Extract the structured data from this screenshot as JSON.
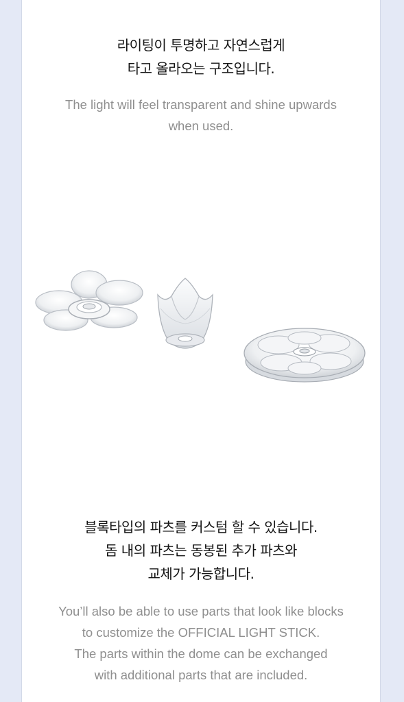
{
  "section1": {
    "ko_lines": [
      "라이팅이 투명하고 자연스럽게",
      "타고 올라오는 구조입니다."
    ],
    "en_lines": [
      "The light will feel transparent and shine upwards",
      "when used."
    ]
  },
  "section2": {
    "ko_lines": [
      "블록타입의 파츠를 커스텀 할 수 있습니다.",
      "돔 내의 파츠는 동봉된 추가 파츠와",
      "교체가 가능합니다."
    ],
    "en_lines": [
      "You’ll also be able to use parts that look like blocks",
      "to customize the OFFICIAL LIGHT STICK.",
      "The parts within the dome can be exchanged",
      "with additional parts that are included."
    ]
  },
  "colors": {
    "page_background": "#e4e9f6",
    "panel_background": "#ffffff",
    "korean_text": "#141414",
    "english_text": "#8f8f8f"
  }
}
